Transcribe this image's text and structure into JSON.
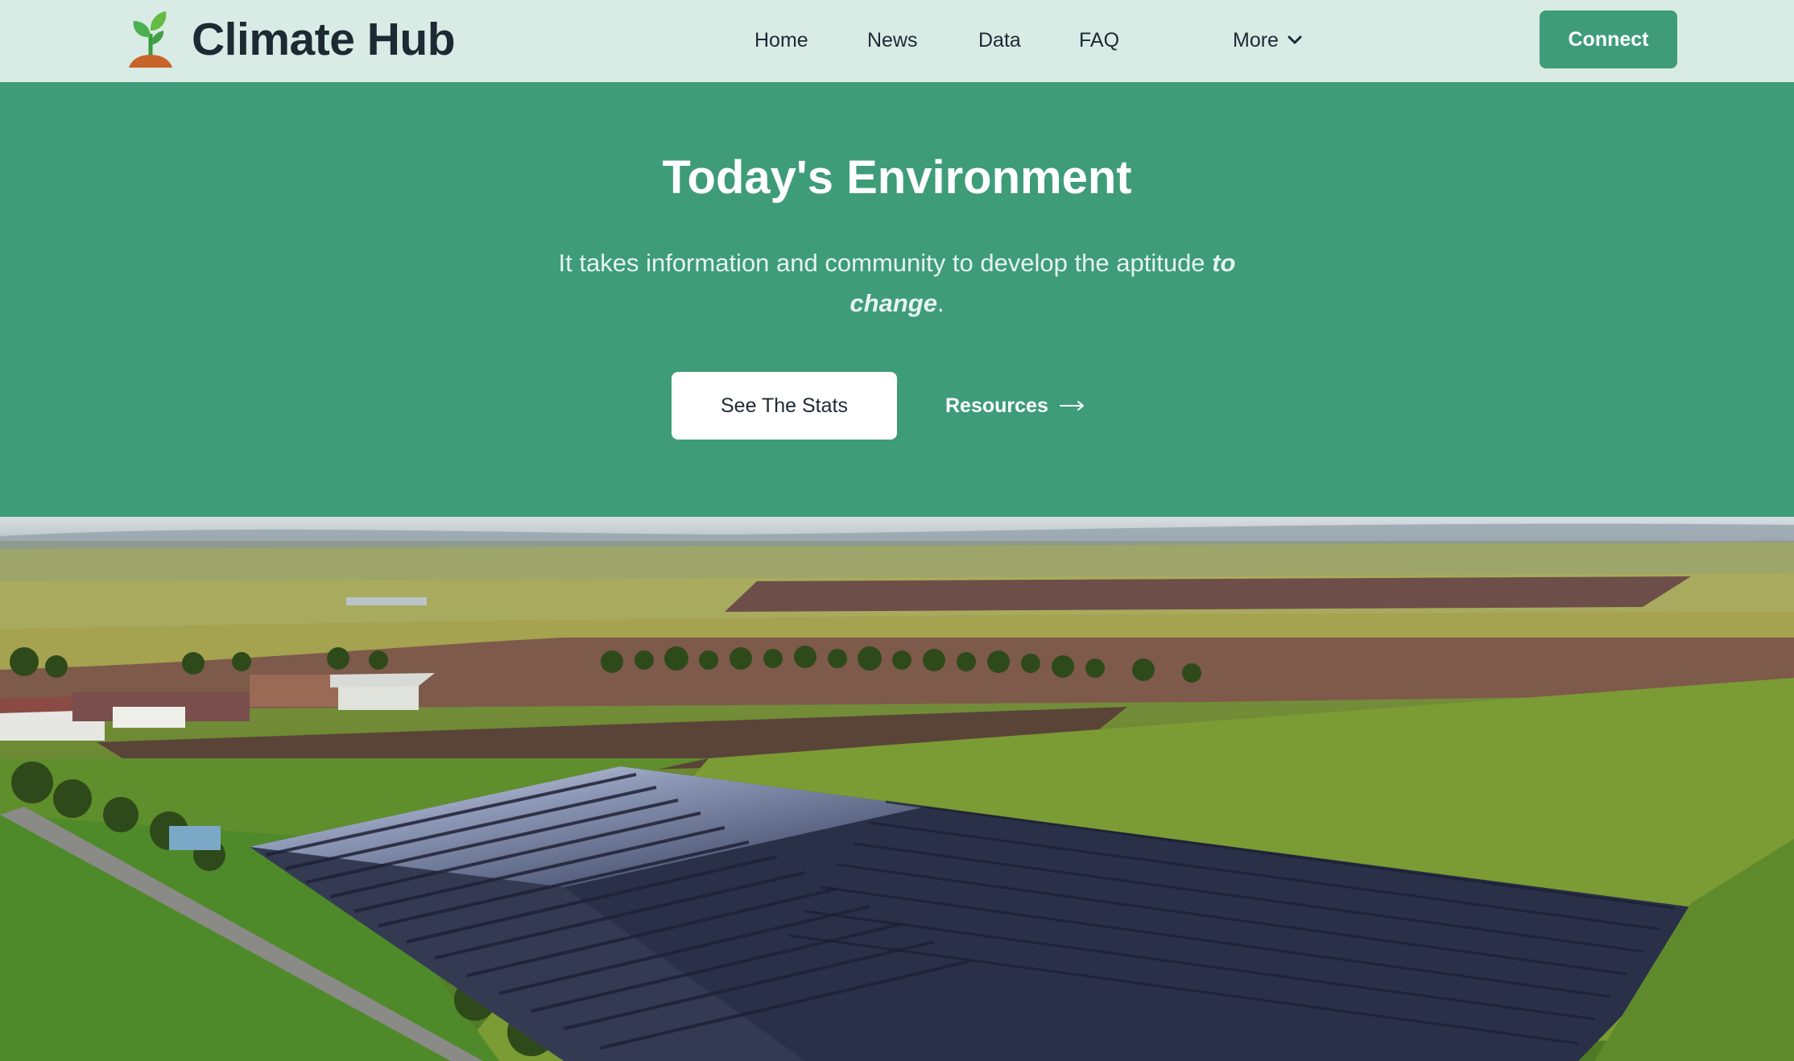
{
  "header": {
    "brand_name": "Climate Hub",
    "logo_icon": "sprout-icon",
    "nav": {
      "home": "Home",
      "news": "News",
      "data": "Data",
      "faq": "FAQ",
      "more": "More"
    },
    "more_icon": "chevron-down-icon",
    "connect_label": "Connect"
  },
  "hero": {
    "title": "Today's Environment",
    "subtitle_plain": "It takes information and community to develop the aptitude",
    "subtitle_emphasis": "to change",
    "subtitle_end": ".",
    "primary_button": "See The Stats",
    "secondary_link": "Resources",
    "secondary_icon": "arrow-right-icon"
  },
  "photo": {
    "subject": "solar-farm-photo"
  },
  "colors": {
    "header_bg": "#d9ebe5",
    "accent": "#3e9c78",
    "text_dark": "#1d2a33",
    "white": "#ffffff"
  }
}
